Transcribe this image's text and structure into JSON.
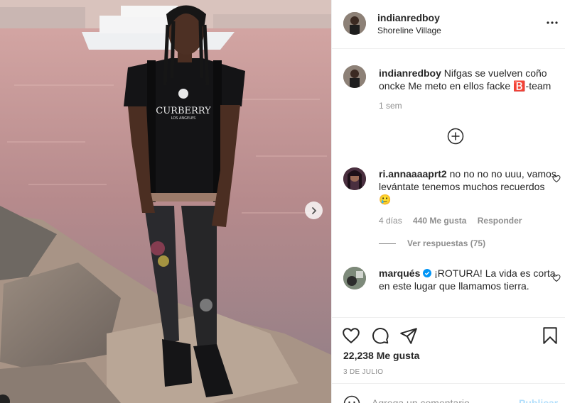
{
  "post": {
    "username": "indianredboy",
    "location": "Shoreline Village",
    "caption": "Nifgas se vuelven coño oncke Me meto en ellos facke 🅱️-team",
    "caption_time": "1 sem",
    "likes": "22,238 Me gusta",
    "date": "3 DE JULIO"
  },
  "shirt_text": {
    "brand": "CURBERRY",
    "city": "LOS ANGELES"
  },
  "comments": [
    {
      "username": "ri.annaaaaprt2",
      "text": "no no no no uuu, vamos levántate tenemos muchos recuerdos 🥲",
      "time": "4 días",
      "likes": "440 Me gusta",
      "reply": "Responder",
      "view_replies": "Ver respuestas (75)"
    },
    {
      "username": "marqués",
      "verified": true,
      "text": "¡ROTURA! La vida es corta en este lugar que llamamos tierra."
    }
  ],
  "add_comment": {
    "placeholder": "Agrega un comentario...",
    "publish": "Publicar"
  },
  "icons": {
    "more": "more-options-icon",
    "like": "heart-icon",
    "comment": "comment-icon",
    "share": "share-icon",
    "save": "bookmark-icon",
    "next": "chevron-right-icon",
    "load_more": "plus-circle-icon",
    "emoji": "smiley-icon",
    "verified": "verified-badge-icon"
  },
  "colors": {
    "text": "#262626",
    "muted": "#8e8e8e",
    "border": "#efefef",
    "verified": "#0095f6",
    "publish_disabled": "#b2dffc"
  }
}
